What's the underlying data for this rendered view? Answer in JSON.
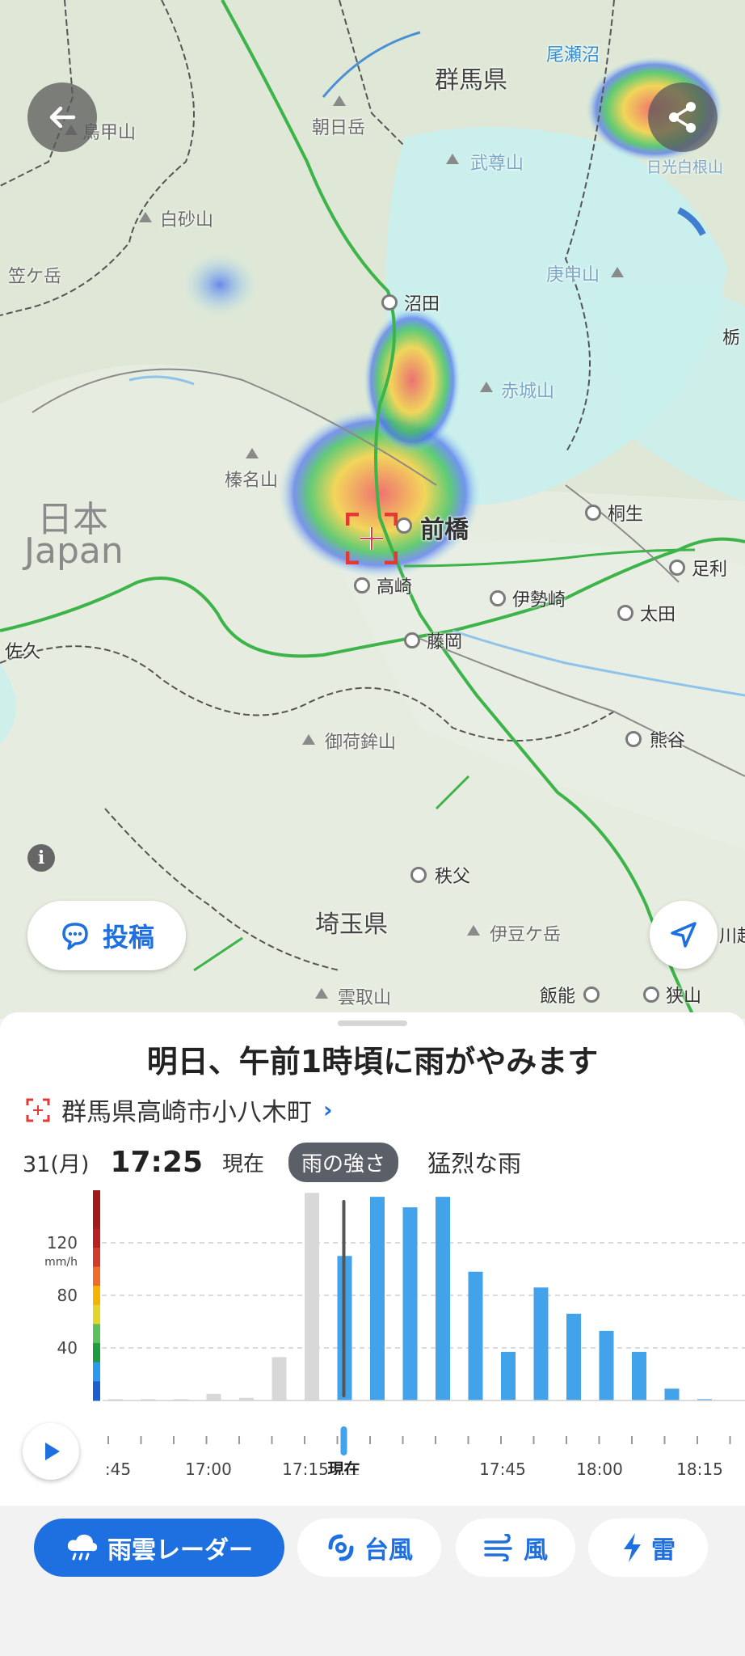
{
  "map": {
    "region_ja": "日本",
    "region_en": "Japan",
    "prefectures": [
      "群馬県",
      "埼玉県"
    ],
    "cities": [
      "前橋",
      "高崎",
      "沼田",
      "桐生",
      "足利",
      "伊勢崎",
      "太田",
      "藤岡",
      "熊谷",
      "秩父",
      "飯能",
      "狭山",
      "佐久"
    ],
    "mountains": [
      "鳥甲山",
      "朝日岳",
      "白砂山",
      "笠ケ岳",
      "武尊山",
      "日光白根山",
      "庚申山",
      "赤城山",
      "榛名山",
      "御荷鉾山",
      "伊豆ケ岳",
      "雲取山"
    ],
    "lakes": [
      "尾瀬沼"
    ],
    "cutoff_labels": [
      "栃",
      "川越"
    ]
  },
  "buttons": {
    "back": "back-arrow-icon",
    "share": "share-icon",
    "info": "i",
    "post": "投稿",
    "locate": "location-arrow-icon"
  },
  "sheet": {
    "headline": "明日、午前1時頃に雨がやみます",
    "location": "群馬県高崎市小八木町",
    "date": "31(月)",
    "time": "17:25",
    "now": "現在",
    "metric": "雨の強さ",
    "intensity": "猛烈な雨"
  },
  "chart_data": {
    "type": "bar",
    "title": "",
    "unit": "mm/h",
    "yticks": [
      40,
      80,
      120
    ],
    "ylim": [
      0,
      160
    ],
    "bars": {
      "past": [
        1,
        1,
        1,
        5,
        2,
        33,
        158
      ],
      "future": [
        110,
        155,
        147,
        155,
        98,
        37,
        86,
        66,
        53,
        37,
        9,
        1
      ]
    },
    "x_labels": [
      ":45",
      "17:00",
      "17:15",
      "現在",
      "17:45",
      "18:00",
      "18:15"
    ],
    "now_label": "現在",
    "colors": {
      "past": "#d8d8d8",
      "future": "#42a3ea",
      "now_line": "#555555"
    }
  },
  "tabs": [
    {
      "label": "雨雲レーダー",
      "icon": "rain-cloud-icon",
      "active": true
    },
    {
      "label": "台風",
      "icon": "typhoon-icon",
      "active": false
    },
    {
      "label": "風",
      "icon": "wind-icon",
      "active": false
    },
    {
      "label": "雷",
      "icon": "lightning-icon",
      "active": false
    }
  ],
  "colors": {
    "accent": "#1e6fe0",
    "alert": "#e53935"
  }
}
